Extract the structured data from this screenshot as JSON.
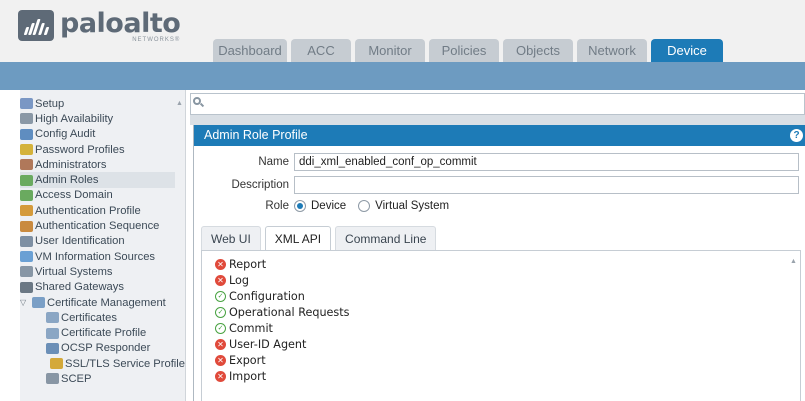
{
  "brand": {
    "name": "paloalto",
    "sub": "NETWORKS®"
  },
  "tabs": [
    {
      "label": "Dashboard",
      "active": false
    },
    {
      "label": "ACC",
      "active": false
    },
    {
      "label": "Monitor",
      "active": false
    },
    {
      "label": "Policies",
      "active": false
    },
    {
      "label": "Objects",
      "active": false
    },
    {
      "label": "Network",
      "active": false
    },
    {
      "label": "Device",
      "active": true
    }
  ],
  "sidebar": {
    "items": [
      {
        "label": "Setup",
        "icon": "setup-icon",
        "color": "#7a97c4",
        "indent": 0,
        "selected": false
      },
      {
        "label": "High Availability",
        "icon": "high-availability-icon",
        "color": "#8a98a6",
        "indent": 0,
        "selected": false
      },
      {
        "label": "Config Audit",
        "icon": "config-audit-icon",
        "color": "#5f8dc0",
        "indent": 0,
        "selected": false
      },
      {
        "label": "Password Profiles",
        "icon": "password-profiles-icon",
        "color": "#d4b23a",
        "indent": 0,
        "selected": false
      },
      {
        "label": "Administrators",
        "icon": "administrators-icon",
        "color": "#b0785a",
        "indent": 0,
        "selected": false
      },
      {
        "label": "Admin Roles",
        "icon": "admin-roles-icon",
        "color": "#6aaa5f",
        "indent": 0,
        "selected": true
      },
      {
        "label": "Access Domain",
        "icon": "access-domain-icon",
        "color": "#6aaa5f",
        "indent": 0,
        "selected": false
      },
      {
        "label": "Authentication Profile",
        "icon": "authentication-profile-icon",
        "color": "#d49a3a",
        "indent": 0,
        "selected": false
      },
      {
        "label": "Authentication Sequence",
        "icon": "authentication-sequence-icon",
        "color": "#c98a3f",
        "indent": 0,
        "selected": false
      },
      {
        "label": "User Identification",
        "icon": "user-identification-icon",
        "color": "#7d8fa3",
        "indent": 0,
        "selected": false
      },
      {
        "label": "VM Information Sources",
        "icon": "vm-information-sources-icon",
        "color": "#6aa0d4",
        "indent": 0,
        "selected": false
      },
      {
        "label": "Virtual Systems",
        "icon": "virtual-systems-icon",
        "color": "#8796a5",
        "indent": 0,
        "selected": false
      },
      {
        "label": "Shared Gateways",
        "icon": "shared-gateways-icon",
        "color": "#6b7884",
        "indent": 0,
        "selected": false
      },
      {
        "label": "Certificate Management",
        "icon": "certificate-management-icon",
        "color": "#7a9fc6",
        "indent": 1,
        "selected": false,
        "caret": "▽"
      },
      {
        "label": "Certificates",
        "icon": "certificates-icon",
        "color": "#8aa6c4",
        "indent": 2,
        "selected": false
      },
      {
        "label": "Certificate Profile",
        "icon": "certificate-profile-icon",
        "color": "#8aa6c4",
        "indent": 2,
        "selected": false
      },
      {
        "label": "OCSP Responder",
        "icon": "ocsp-responder-icon",
        "color": "#6b8fb7",
        "indent": 2,
        "selected": false
      },
      {
        "label": "SSL/TLS Service Profile",
        "icon": "ssl-tls-service-profile-icon",
        "color": "#d4a93a",
        "indent": 3,
        "selected": false
      },
      {
        "label": "SCEP",
        "icon": "scep-icon",
        "color": "#8896a4",
        "indent": 2,
        "selected": false
      }
    ]
  },
  "dialog": {
    "title": "Admin Role Profile",
    "name_label": "Name",
    "name_value": "ddi_xml_enabled_conf_op_commit",
    "description_label": "Description",
    "description_value": "",
    "role_label": "Role",
    "role_options": [
      {
        "label": "Device",
        "selected": true
      },
      {
        "label": "Virtual System",
        "selected": false
      }
    ],
    "sub_tabs": [
      {
        "label": "Web UI",
        "active": false
      },
      {
        "label": "XML API",
        "active": true
      },
      {
        "label": "Command Line",
        "active": false
      }
    ],
    "permissions": [
      {
        "label": "Report",
        "status": "deny"
      },
      {
        "label": "Log",
        "status": "deny"
      },
      {
        "label": "Configuration",
        "status": "allow"
      },
      {
        "label": "Operational Requests",
        "status": "allow"
      },
      {
        "label": "Commit",
        "status": "allow"
      },
      {
        "label": "User-ID Agent",
        "status": "deny"
      },
      {
        "label": "Export",
        "status": "deny"
      },
      {
        "label": "Import",
        "status": "deny"
      }
    ]
  },
  "colors": {
    "accent": "#1d7bb7",
    "deny": "#e04a3b",
    "allow": "#49a342",
    "bar": "#6d9bc1"
  }
}
